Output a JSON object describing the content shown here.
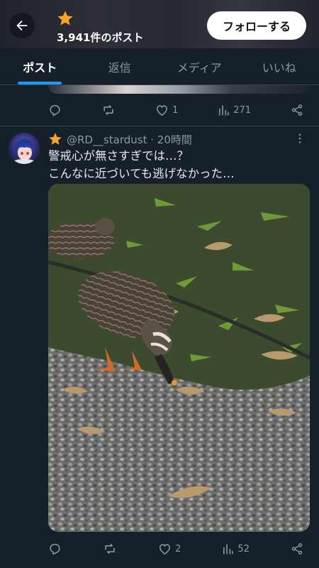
{
  "header": {
    "post_count": "3,941件のポスト",
    "follow_label": "フォローする",
    "star_color": "#f6a623"
  },
  "tabs": [
    {
      "label": "ポスト",
      "active": true
    },
    {
      "label": "返信",
      "active": false
    },
    {
      "label": "メディア",
      "active": false
    },
    {
      "label": "いいね",
      "active": false
    }
  ],
  "prev_post": {
    "likes": "1",
    "views": "271"
  },
  "post": {
    "handle": "@RD__stardust · 20時間",
    "text_line1": "警戒心が無さすぎでは…？",
    "text_line2": "こんなに近づいても逃げなかった…",
    "likes": "2",
    "views": "52"
  },
  "colors": {
    "background": "#15202b",
    "accent": "#1d9bf0",
    "muted": "#8b98a5"
  }
}
